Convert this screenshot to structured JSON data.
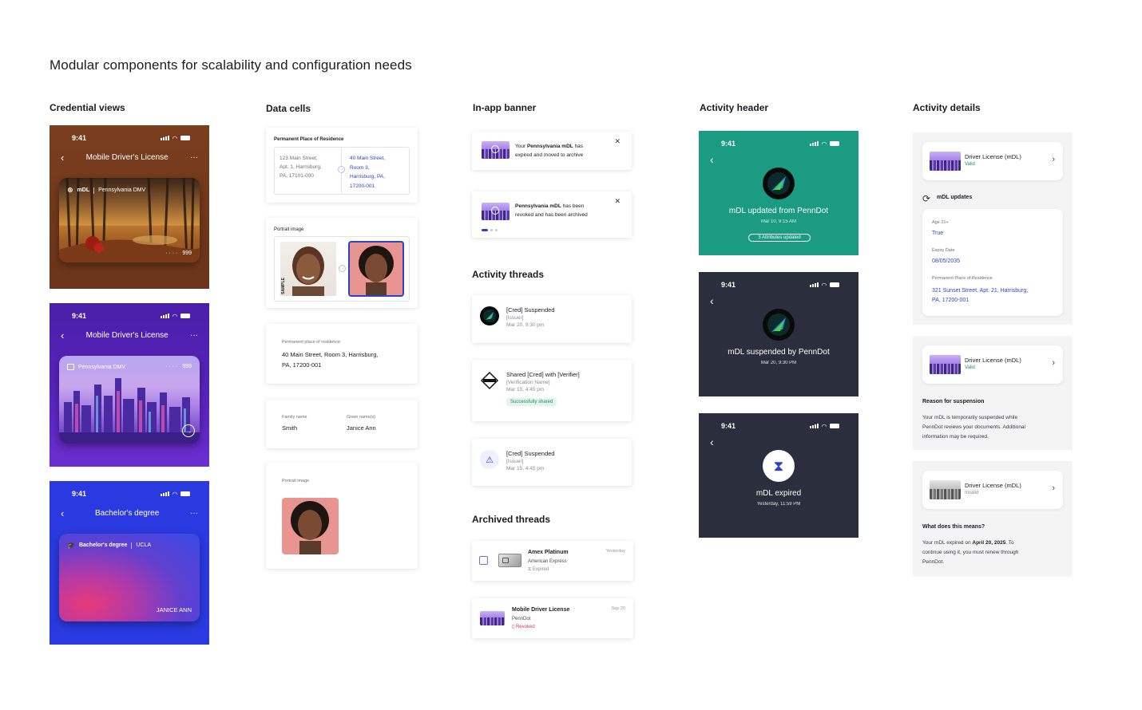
{
  "page": {
    "title": "Modular components for scalability and configuration needs"
  },
  "columns": {
    "credential_views": "Credential views",
    "data_cells": "Data cells",
    "in_app_banner": "In-app banner",
    "activity_header": "Activity header",
    "activity_details": "Activity details"
  },
  "phones": {
    "time": "9:41",
    "more": "···",
    "mdl_title": "Mobile Driver's License",
    "degree_title": "Bachelor's degree"
  },
  "credential_cards": {
    "card1": {
      "badge": "mDL",
      "issuer": "Pennsylvania DMV",
      "dots": "· · · ·",
      "num": "999"
    },
    "card2": {
      "issuer": "Pennsylvania DMV",
      "dots": "· · · ·",
      "num": "999"
    },
    "card3": {
      "badge": "Bachelor's degree",
      "issuer": "UCLA",
      "holder": "JANICE ANN"
    }
  },
  "data_cells": {
    "residence": {
      "label": "Permanent Place of Residence",
      "old_lines": [
        "123 Main Street,",
        "Apt. 1, Harrisburg,",
        "PA, 17101-000"
      ],
      "new_lines": [
        "40 Main Street,",
        "Room 3,",
        "Harrisburg, PA,",
        "17200-001"
      ]
    },
    "portrait_compare": {
      "label": "Portrait image",
      "side_text": "SAMPLE"
    },
    "residence_simple": {
      "label": "Permanent place of residence",
      "line1": "40 Main Street, Room 3, Harrisburg,",
      "line2": "PA, 17200-001"
    },
    "names": {
      "family_label": "Family name",
      "family_value": "Smith",
      "given_label": "Given name(s)",
      "given_value": "Janice Ann"
    },
    "portrait_single": {
      "label": "Portrait image"
    }
  },
  "banners": [
    {
      "pre": "Your ",
      "bold": "Pennsylvania mDL",
      "post": " has",
      "line2": "expired and moved to archive",
      "close": "✕"
    },
    {
      "pre": "",
      "bold": "Pennsylvania mDL",
      "post": " has been",
      "line2": "revoked and has been archived",
      "close": "✕"
    }
  ],
  "activity_threads": {
    "title": "Activity threads",
    "items": [
      {
        "title": "[Cred] Suspended",
        "sub": "[Issuer]",
        "date": "Mar 20, 9:30 pm"
      },
      {
        "title": "Shared [Cred] with [Verifier]",
        "sub": "[Verification Name]",
        "date": "Mar 15, 4:45 pm",
        "badge": "Successfully shared"
      },
      {
        "title": "[Cred] Suspended",
        "sub": "[Issuer]",
        "date": "Mar 15, 4:45 pm"
      }
    ]
  },
  "archived_threads": {
    "title": "Archived threads",
    "items": [
      {
        "title": "Amex Platinum",
        "sub": "American Express",
        "status": "Expired",
        "date": "Yesterday"
      },
      {
        "title": "Mobile Driver License",
        "sub": "PennDot",
        "status": "Revoked",
        "date": "Sep 20"
      }
    ]
  },
  "activity_headers": [
    {
      "title": "mDL updated from PennDot",
      "date": "Mar 10, 9:15 AM",
      "badge": "3 Attributes updated",
      "bg": "#1a9b82"
    },
    {
      "title": "mDL suspended by PennDot",
      "date": "Mar 20, 9:30 PM",
      "bg": "#2b2f3d"
    },
    {
      "title": "mDL expired",
      "date": "Yesterday, 11:59 PM",
      "bg": "#2b2f3d"
    }
  ],
  "activity_details": {
    "panel1": {
      "card_title": "Driver License (mDL)",
      "card_status": "Valid",
      "updates_title": "mDL updates",
      "fields": [
        {
          "label": "Age 21+",
          "value": "True"
        },
        {
          "label": "Expiry Date",
          "value": "08/05/2035"
        },
        {
          "label": "Permanent Place of Residence",
          "value": "321 Sunset Street, Apt. 21, Harrisburg,",
          "value2": "PA, 17200-001"
        }
      ]
    },
    "panel2": {
      "card_title": "Driver License (mDL)",
      "card_status": "Valid",
      "reason_title": "Reason for suspension",
      "lines": [
        "Your mDL is temporarily suspended while",
        "PennDot reviews your documents. Additional",
        "information may be required."
      ]
    },
    "panel3": {
      "card_title": "Driver License (mDL)",
      "card_status": "Invalid",
      "question": "What does this means?",
      "line1_pre": "Your mDL expired on ",
      "line1_bold": "April 20, 2025",
      "line1_post": ". To",
      "line2": "continue using it, you must renew through",
      "line3": "PennDot."
    }
  },
  "colors": {
    "accent_blue": "#2f43c8",
    "success_green": "#e3f4ee",
    "revoked_red": "#d9365a"
  }
}
